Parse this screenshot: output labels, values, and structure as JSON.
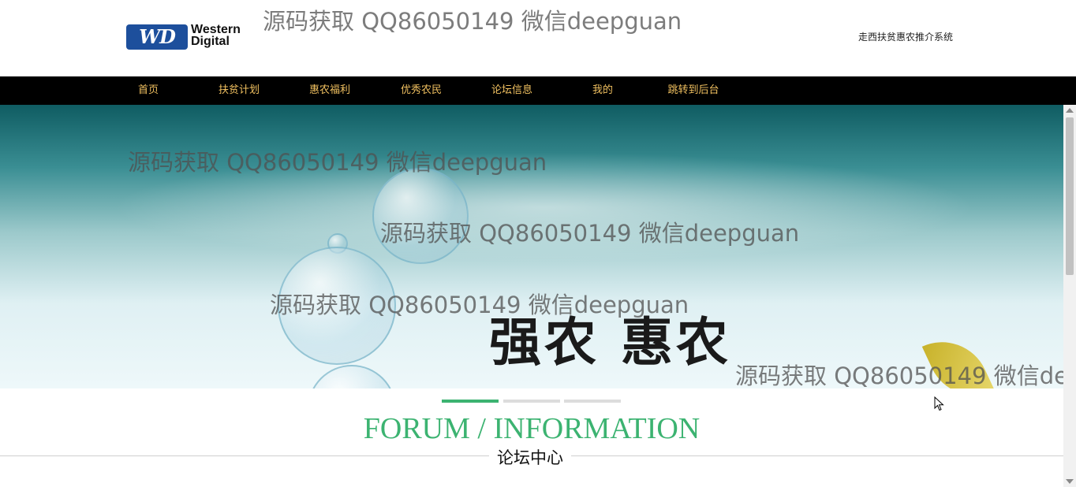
{
  "header": {
    "logo": {
      "badge": "WD",
      "line1": "Western",
      "line2": "Digital"
    },
    "site_title": "走西扶贫惠农推介系统"
  },
  "nav": {
    "items": [
      {
        "label": "首页"
      },
      {
        "label": "扶贫计划"
      },
      {
        "label": "惠农福利"
      },
      {
        "label": "优秀农民"
      },
      {
        "label": "论坛信息"
      },
      {
        "label": "我的"
      },
      {
        "label": "跳转到后台"
      }
    ],
    "text_color": "#f0c060",
    "background": "#000000"
  },
  "banner": {
    "slogan": "强农 惠农",
    "slide_count": 3,
    "active_slide": 1
  },
  "watermark": "源码获取 QQ86050149 微信deepguan",
  "section": {
    "title_en": "FORUM / INFORMATION",
    "title_cn": "论坛中心",
    "accent_color": "#3cb371"
  }
}
